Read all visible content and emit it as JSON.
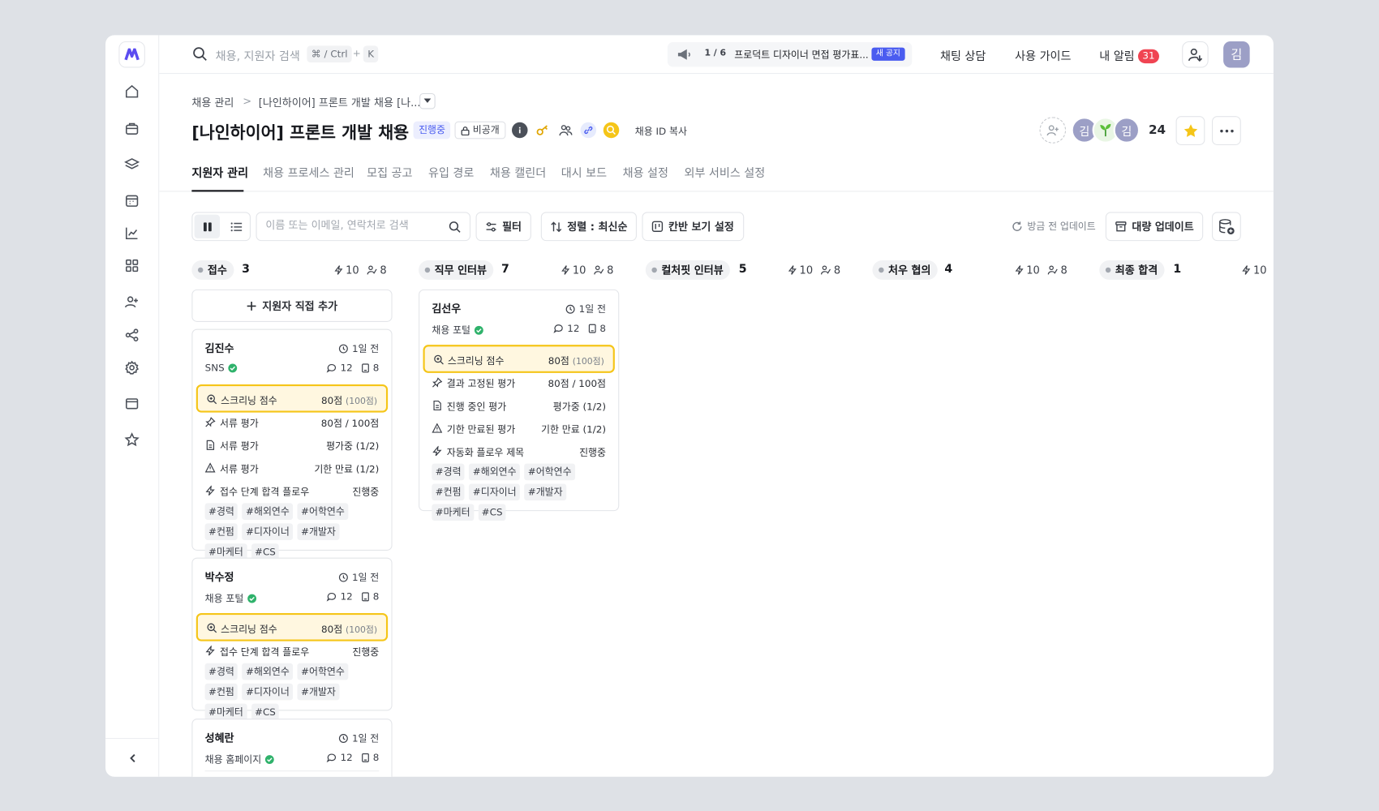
{
  "topbar": {
    "search_placeholder": "채용, 지원자 검색",
    "kbd_cmd": "⌘ / Ctrl",
    "kbd_plus": "+",
    "kbd_k": "K",
    "notice_count": "1 / 6",
    "notice_text": "프로덕트 디자이너 면접 평가표...",
    "notice_badge": "새 공지",
    "chat_label": "채팅 상담",
    "guide_label": "사용 가이드",
    "alerts_label": "내 알림",
    "alerts_count": "31",
    "user_initial": "김"
  },
  "header": {
    "breadcrumb_root": "채용 관리",
    "breadcrumb_sep": ">",
    "breadcrumb_current": "[나인하이어] 프론트 개발 채용 [나...",
    "title": "[나인하이어] 프론트 개발 채용",
    "status": "진행중",
    "visibility": "비공개",
    "copy_id": "채용 ID 복사",
    "member_initial_1": "김",
    "member_initial_3": "김",
    "member_count": "24"
  },
  "tabs": [
    "지원자 관리",
    "채용 프로세스 관리",
    "모집 공고",
    "유입 경로",
    "채용 캘린더",
    "대시 보드",
    "채용 설정",
    "외부 서비스 설정"
  ],
  "toolbar": {
    "search_placeholder": "이름 또는 이메일, 연락처로 검색",
    "filter": "필터",
    "sort": "정렬 : 최신순",
    "kanban_settings": "칸반 보기 설정",
    "refresh": "방금 전 업데이트",
    "bulk_update": "대량 업데이트"
  },
  "columns": [
    {
      "name": "접수",
      "count": "3",
      "bolt": "10",
      "people": "8"
    },
    {
      "name": "직무 인터뷰",
      "count": "7",
      "bolt": "10",
      "people": "8"
    },
    {
      "name": "컬처핏 인터뷰",
      "count": "5",
      "bolt": "10",
      "people": "8"
    },
    {
      "name": "처우 협의",
      "count": "4",
      "bolt": "10",
      "people": "8"
    },
    {
      "name": "최종 합격",
      "count": "1",
      "bolt": "10"
    }
  ],
  "add_applicant": "지원자 직접 추가",
  "cards": {
    "kim_jinsu": {
      "name": "김진수",
      "time": "1일 전",
      "source": "SNS",
      "comments": "12",
      "docs": "8",
      "screening_label": "스크리닝 점수",
      "screening_value": "80점",
      "screening_max": "(100점)",
      "r1_label": "서류 평가",
      "r1_value": "80점 / 100점",
      "r2_label": "서류 평가",
      "r2_value": "평가중 (1/2)",
      "r3_label": "서류 평가",
      "r3_value": "기한 만료 (1/2)",
      "r4_label": "접수 단계 합격 플로우",
      "r4_value": "진행중",
      "tags": [
        "#경력",
        "#해외연수",
        "#어학연수",
        "#컨펌",
        "#디자이너",
        "#개발자",
        "#마케터",
        "#CS"
      ]
    },
    "park_sujeong": {
      "name": "박수정",
      "time": "1일 전",
      "source": "채용 포털",
      "comments": "12",
      "docs": "8",
      "screening_label": "스크리닝 점수",
      "screening_value": "80점",
      "screening_max": "(100점)",
      "r1_label": "접수 단계 합격 플로우",
      "r1_value": "진행중",
      "tags": [
        "#경력",
        "#해외연수",
        "#어학연수",
        "#컨펌",
        "#디자이너",
        "#개발자",
        "#마케터",
        "#CS"
      ]
    },
    "seong_hyeran": {
      "name": "성혜란",
      "time": "1일 전",
      "source": "채용 홈페이지",
      "comments": "12",
      "docs": "8"
    },
    "kim_seonwoo": {
      "name": "김선우",
      "time": "1일 전",
      "source": "채용 포털",
      "comments": "12",
      "docs": "8",
      "screening_label": "스크리닝 점수",
      "screening_value": "80점",
      "screening_max": "(100점)",
      "r1_label": "결과 고정된 평가",
      "r1_value": "80점 / 100점",
      "r2_label": "진행 중인 평가",
      "r2_value": "평가중 (1/2)",
      "r3_label": "기한 만료된 평가",
      "r3_value": "기한 만료 (1/2)",
      "r4_label": "자동화 플로우 제목",
      "r4_value": "진행중",
      "tags": [
        "#경력",
        "#해외연수",
        "#어학연수",
        "#컨펌",
        "#디자이너",
        "#개발자",
        "#마케터",
        "#CS"
      ]
    }
  },
  "colors": {
    "accent": "#4a5cf0",
    "highlight": "#f5c518",
    "alert": "#f04452",
    "verified": "#2fb26b"
  }
}
